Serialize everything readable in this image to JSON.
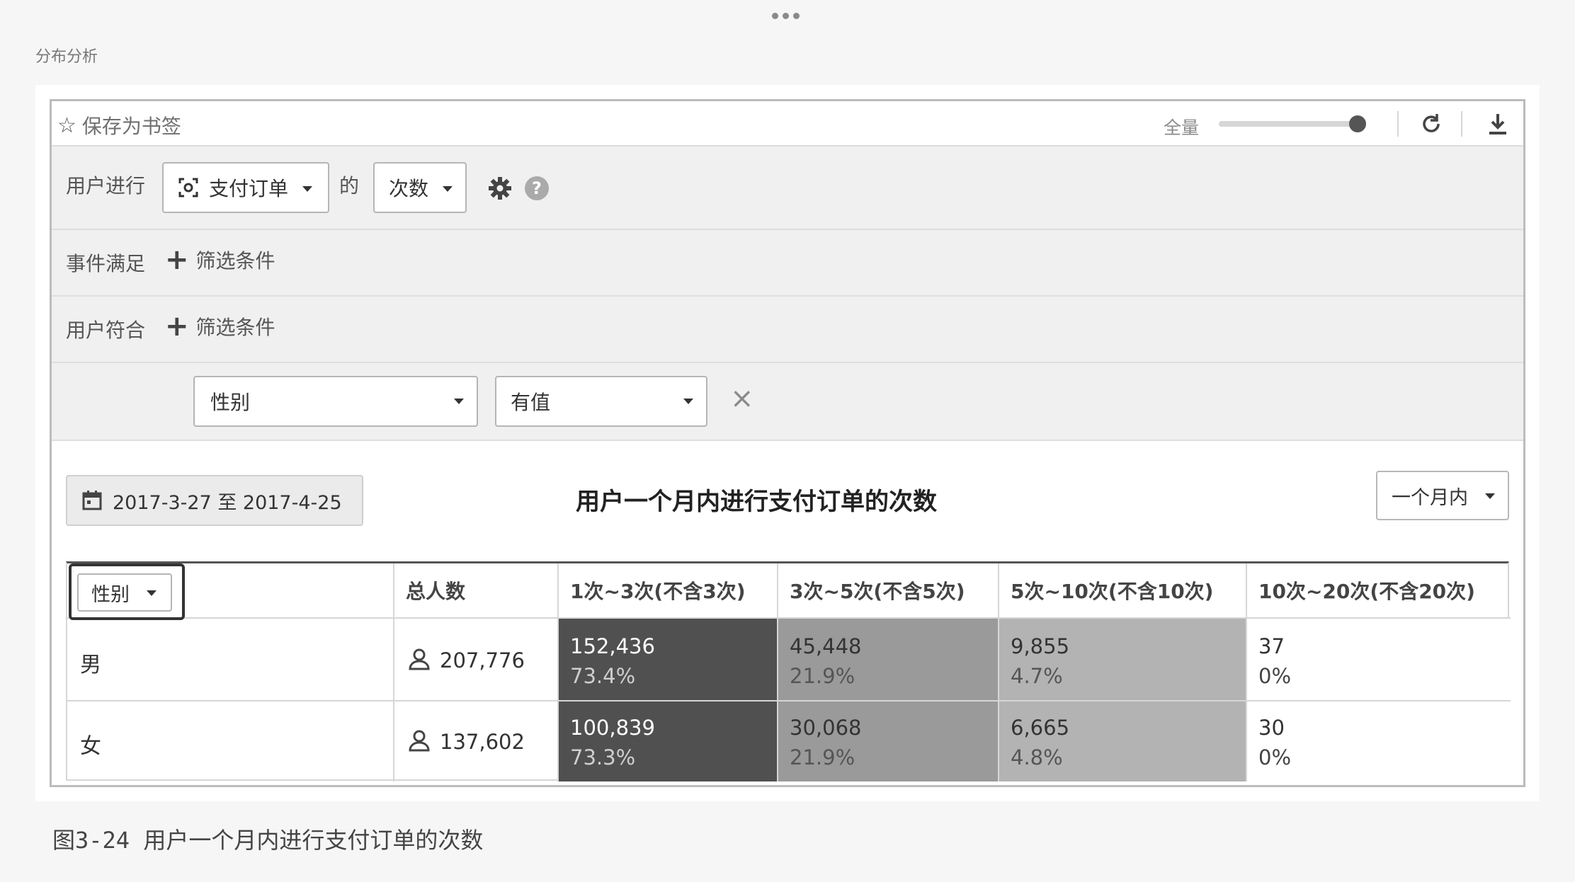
{
  "section_label": "分布分析",
  "toolbar": {
    "bookmark_label": "保存为书签",
    "scope_label": "全量",
    "scope_value_pct": 100
  },
  "query": {
    "user_does_label": "用户进行",
    "event": "支付订单",
    "of_label": "的",
    "metric": "次数",
    "event_filter_label": "事件满足",
    "add_filter_label": "筛选条件",
    "user_filter_label": "用户符合",
    "user_add_filter_label": "筛选条件",
    "property": "性别",
    "operator": "有值"
  },
  "result": {
    "date_range": "2017-3-27 至 2017-4-25",
    "title": "用户一个月内进行支付订单的次数",
    "period": "一个月内"
  },
  "table": {
    "group_by": "性别",
    "headers": [
      "总人数",
      "1次~3次(不含3次)",
      "3次~5次(不含5次)",
      "5次~10次(不含10次)",
      "10次~20次(不含20次)"
    ],
    "rows": [
      {
        "label": "男",
        "total": "207,776",
        "cells": [
          {
            "count": "152,436",
            "pct": "73.4%"
          },
          {
            "count": "45,448",
            "pct": "21.9%"
          },
          {
            "count": "9,855",
            "pct": "4.7%"
          },
          {
            "count": "37",
            "pct": "0%"
          }
        ]
      },
      {
        "label": "女",
        "total": "137,602",
        "cells": [
          {
            "count": "100,839",
            "pct": "73.3%"
          },
          {
            "count": "30,068",
            "pct": "21.9%"
          },
          {
            "count": "6,665",
            "pct": "4.8%"
          },
          {
            "count": "30",
            "pct": "0%"
          }
        ]
      }
    ],
    "column_shades": [
      "#505050",
      "#9a9a9a",
      "#b3b3b3",
      "#ffffff"
    ],
    "column_text": [
      "#ffffff",
      "#333333",
      "#333333",
      "#333333"
    ],
    "column_pct_text": [
      "#cfcfcf",
      "#555555",
      "#555555",
      "#444444"
    ]
  },
  "caption": "图3-24 用户一个月内进行支付订单的次数"
}
